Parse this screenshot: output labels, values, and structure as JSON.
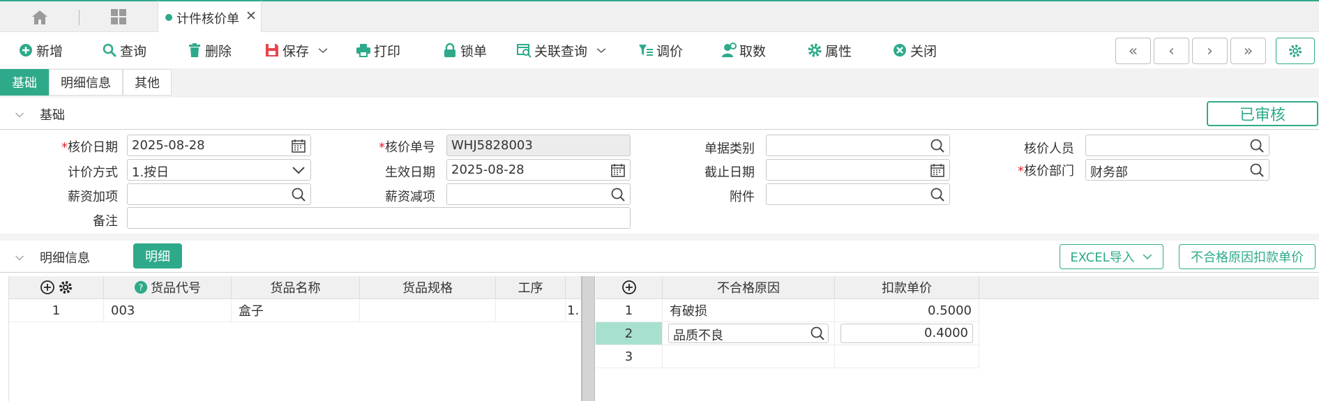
{
  "window": {
    "tab_title": "计件核价单"
  },
  "toolbar": {
    "new": "新增",
    "query": "查询",
    "delete": "删除",
    "save": "保存",
    "print": "打印",
    "lock": "锁单",
    "related_query": "关联查询",
    "adjust_price": "调价",
    "fetch": "取数",
    "properties": "属性",
    "close": "关闭"
  },
  "nav": {
    "first": "«",
    "prev": "‹",
    "next": "›",
    "last": "»"
  },
  "subtabs": {
    "basic": "基础",
    "detail_info": "明细信息",
    "other": "其他"
  },
  "basic_section": {
    "title": "基础",
    "status": "已审核"
  },
  "form": {
    "pricing_date": {
      "label": "核价日期",
      "value": "2025-08-28"
    },
    "pricing_no": {
      "label": "核价单号",
      "value": "WHJ5828003"
    },
    "doc_type": {
      "label": "单据类别",
      "value": ""
    },
    "pricing_person": {
      "label": "核价人员",
      "value": ""
    },
    "pricing_method": {
      "label": "计价方式",
      "value": "1.按日"
    },
    "effective_date": {
      "label": "生效日期",
      "value": "2025-08-28"
    },
    "end_date": {
      "label": "截止日期",
      "value": ""
    },
    "pricing_dept": {
      "label": "核价部门",
      "value": "财务部"
    },
    "salary_add": {
      "label": "薪资加项",
      "value": ""
    },
    "salary_sub": {
      "label": "薪资减项",
      "value": ""
    },
    "attachment": {
      "label": "附件",
      "value": ""
    },
    "remark": {
      "label": "备注",
      "value": ""
    },
    "required_mark": "*"
  },
  "detail_section": {
    "title": "明细信息",
    "detail_button": "明细",
    "excel_import": "EXCEL导入",
    "deduct_button": "不合格原因扣款单价"
  },
  "left_grid": {
    "columns": [
      "货品代号",
      "货品名称",
      "货品规格",
      "工序"
    ],
    "rows": [
      {
        "no": "1",
        "code": "003",
        "name": "盒子",
        "spec": "",
        "process": "",
        "extra": "1."
      }
    ]
  },
  "right_grid": {
    "columns": [
      "不合格原因",
      "扣款单价"
    ],
    "rows": [
      {
        "no": "1",
        "reason": "有破损",
        "price": "0.5000"
      },
      {
        "no": "2",
        "reason": "品质不良",
        "price": "0.4000"
      },
      {
        "no": "3",
        "reason": "",
        "price": ""
      }
    ]
  },
  "colors": {
    "accent": "#2eaa8a",
    "required": "#e0242b",
    "selected_row": "#a8e0d0"
  }
}
